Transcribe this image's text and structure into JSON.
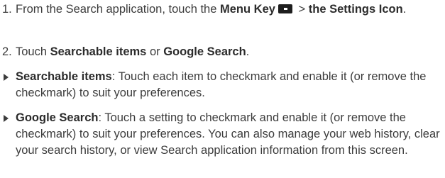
{
  "steps": [
    {
      "number": "1.",
      "pre": "From the Search application, touch the ",
      "bold1": "Menu Key",
      "icon": "menu-key-icon",
      "mid": " > ",
      "bold2": "the Settings Icon",
      "post": "."
    },
    {
      "number": "2.",
      "pre": "Touch ",
      "bold1": "Searchable items",
      "mid": " or ",
      "bold2": "Google Search",
      "post": "."
    }
  ],
  "bullets": [
    {
      "bold": "Searchable items",
      "text": ": Touch each item to checkmark and enable it (or remove the checkmark) to suit your preferences."
    },
    {
      "bold": "Google Search",
      "text": ": Touch a setting to checkmark and enable it (or remove the checkmark) to suit your preferences. You can also manage your web history, clear your search history, or view Search application information from this screen."
    }
  ]
}
